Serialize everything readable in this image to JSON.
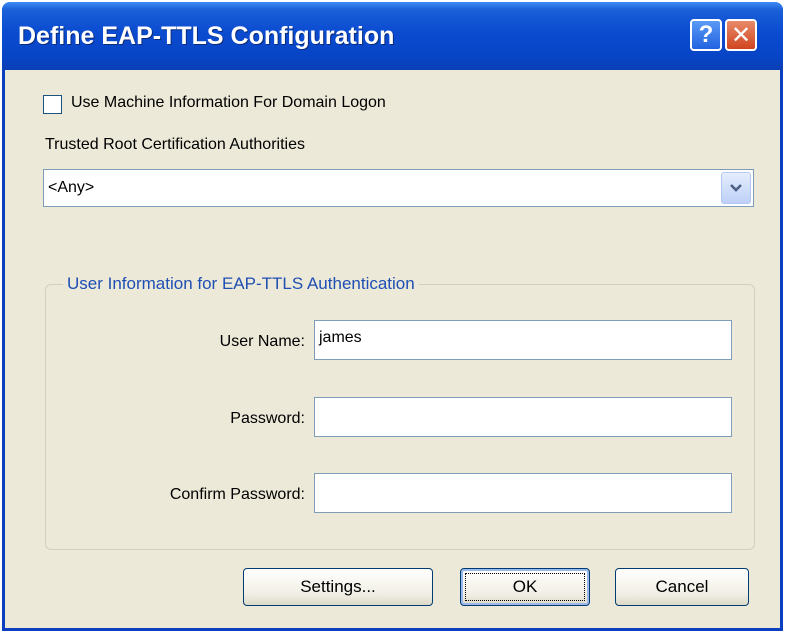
{
  "window": {
    "title": "Define EAP-TTLS Configuration",
    "help_label": "?",
    "close_label": "✕"
  },
  "machine_info_checkbox": {
    "label": "Use Machine Information For Domain Logon",
    "checked": false
  },
  "trusted_roots": {
    "label": "Trusted Root Certification Authorities",
    "selected": "<Any>"
  },
  "user_info": {
    "group_title": "User Information for EAP-TTLS Authentication",
    "user_name_label": "User Name:",
    "user_name_value": "james",
    "password_label": "Password:",
    "password_value": "",
    "confirm_password_label": "Confirm Password:",
    "confirm_password_value": ""
  },
  "buttons": {
    "settings": "Settings...",
    "ok": "OK",
    "cancel": "Cancel"
  },
  "icons": {
    "help": "help-icon",
    "close": "close-icon",
    "dropdown": "chevron-down-icon"
  }
}
